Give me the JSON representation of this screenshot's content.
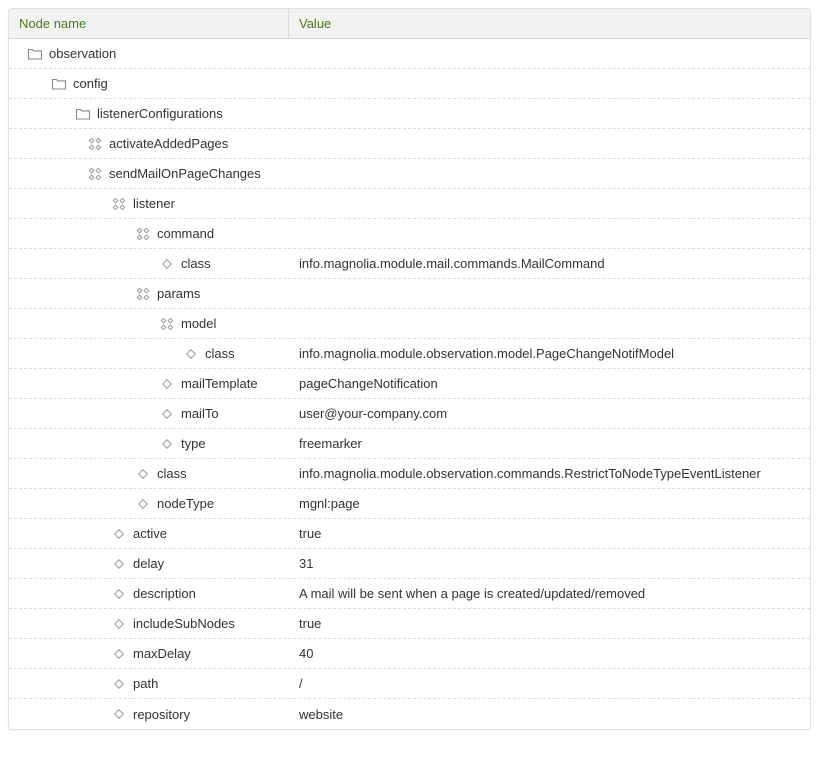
{
  "header": {
    "col_name": "Node name",
    "col_value": "Value"
  },
  "rows": [
    {
      "level": 0,
      "icon": "folder",
      "name": "observation",
      "value": ""
    },
    {
      "level": 1,
      "icon": "folder",
      "name": "config",
      "value": ""
    },
    {
      "level": 2,
      "icon": "folder",
      "name": "listenerConfigurations",
      "value": ""
    },
    {
      "level": 3,
      "icon": "content",
      "name": "activateAddedPages",
      "value": ""
    },
    {
      "level": 3,
      "icon": "content",
      "name": "sendMailOnPageChanges",
      "value": ""
    },
    {
      "level": 4,
      "icon": "content",
      "name": "listener",
      "value": ""
    },
    {
      "level": 5,
      "icon": "content",
      "name": "command",
      "value": ""
    },
    {
      "level": 6,
      "icon": "prop",
      "name": "class",
      "value": "info.magnolia.module.mail.commands.MailCommand"
    },
    {
      "level": 5,
      "icon": "content",
      "name": "params",
      "value": ""
    },
    {
      "level": 6,
      "icon": "content",
      "name": "model",
      "value": ""
    },
    {
      "level": 7,
      "icon": "prop",
      "name": "class",
      "value": "info.magnolia.module.observation.model.PageChangeNotifModel"
    },
    {
      "level": 6,
      "icon": "prop",
      "name": "mailTemplate",
      "value": "pageChangeNotification"
    },
    {
      "level": 6,
      "icon": "prop",
      "name": "mailTo",
      "value": "user@your-company.com"
    },
    {
      "level": 6,
      "icon": "prop",
      "name": "type",
      "value": "freemarker"
    },
    {
      "level": 5,
      "icon": "prop",
      "name": "class",
      "value": "info.magnolia.module.observation.commands.RestrictToNodeTypeEventListener"
    },
    {
      "level": 5,
      "icon": "prop",
      "name": "nodeType",
      "value": "mgnl:page"
    },
    {
      "level": 4,
      "icon": "prop",
      "name": "active",
      "value": "true"
    },
    {
      "level": 4,
      "icon": "prop",
      "name": "delay",
      "value": "31"
    },
    {
      "level": 4,
      "icon": "prop",
      "name": "description",
      "value": "A mail will be sent when a page is created/updated/removed"
    },
    {
      "level": 4,
      "icon": "prop",
      "name": "includeSubNodes",
      "value": "true"
    },
    {
      "level": 4,
      "icon": "prop",
      "name": "maxDelay",
      "value": "40"
    },
    {
      "level": 4,
      "icon": "prop",
      "name": "path",
      "value": "/"
    },
    {
      "level": 4,
      "icon": "prop",
      "name": "repository",
      "value": "website"
    }
  ]
}
